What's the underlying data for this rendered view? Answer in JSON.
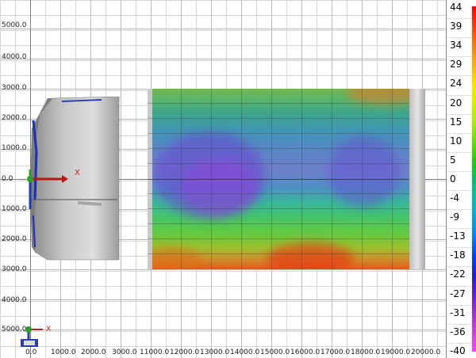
{
  "y_axis_labels": [
    "5000.0",
    "4000.0",
    "3000.0",
    "2000.0",
    "1000.0",
    "0.0",
    "1000.0",
    "2000.0",
    "3000.0",
    "4000.0",
    "5000.0"
  ],
  "x_axis_labels": [
    "0.0",
    "1000.0",
    "2000.0",
    "3000.0",
    "11000.0",
    "12000.0",
    "13000.0",
    "14000.0",
    "15000.0",
    "16000.0",
    "17000.0",
    "18000.0",
    "19000.0",
    "20000.0"
  ],
  "origin_axis": {
    "x_label": "X"
  },
  "corner_axis": {
    "x_label": "X"
  },
  "legend": {
    "labels": [
      "44",
      "39",
      "34",
      "29",
      "24",
      "20",
      "15",
      "10",
      "5",
      "0",
      "-4",
      "-9",
      "-13",
      "-18",
      "-22",
      "-27",
      "-31",
      "-36",
      "-40"
    ],
    "colors": [
      "#ff0000",
      "#ff3b00",
      "#ff7a00",
      "#ffb000",
      "#ffe000",
      "#d8f000",
      "#a8f000",
      "#6ae000",
      "#20d000",
      "#00c060",
      "#00c0a8",
      "#00a8d8",
      "#0080ff",
      "#0040ff",
      "#2020d0",
      "#6020d0",
      "#9830e0",
      "#d040e0",
      "#ff40ff"
    ]
  },
  "colors": {
    "grid": "#d7d7d7",
    "major_grid": "#b9b9b9",
    "axis_x": "#c0201b",
    "axis_y": "#2060d0",
    "axis_z": "#2aa02a"
  }
}
